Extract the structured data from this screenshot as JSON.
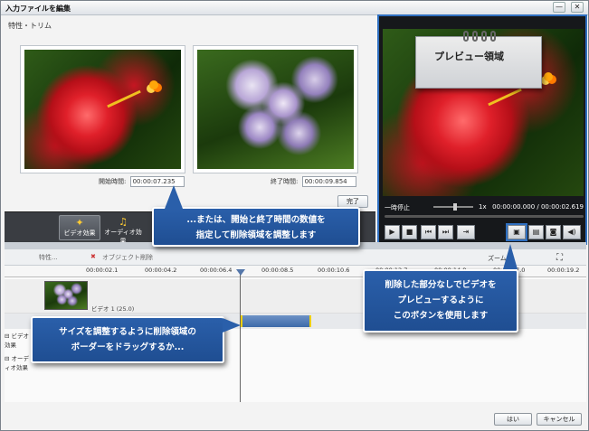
{
  "window": {
    "title": "入力ファイルを編集",
    "min_label": "—",
    "close_label": "✕"
  },
  "section": {
    "label": "特性・トリム"
  },
  "start_time": {
    "label": "開始時間:",
    "value": "00:00:07.235"
  },
  "end_time": {
    "label": "終了時間:",
    "value": "00:00:09.854"
  },
  "complete_button": "完了",
  "effects": [
    {
      "label": "ビデオ効果",
      "icon": "✦"
    },
    {
      "label": "オーディオ効果",
      "icon": "♫"
    }
  ],
  "preview_note": "プレビュー領域",
  "preview": {
    "pause_label": "一時停止",
    "zoom": "1x",
    "time": "00:00:00.000 / 00:00:02.619"
  },
  "player_controls": [
    {
      "name": "play-icon",
      "glyph": "▶"
    },
    {
      "name": "stop-icon",
      "glyph": "■"
    },
    {
      "name": "prev-frame-icon",
      "glyph": "⏮"
    },
    {
      "name": "next-frame-icon",
      "glyph": "⏭"
    },
    {
      "name": "preview-trim-icon",
      "glyph": "⇥"
    },
    {
      "name": "preview-without-deleted-icon",
      "glyph": "▣"
    },
    {
      "name": "snapshot-settings-icon",
      "glyph": "▤"
    },
    {
      "name": "camera-icon",
      "glyph": "◙"
    },
    {
      "name": "volume-icon",
      "glyph": "◀)"
    }
  ],
  "timeline": {
    "tools": [
      "特性...",
      "オブジェクト削除"
    ],
    "zoom_label": "ズーム:",
    "ticks": [
      "00:00:02.1",
      "00:00:04.2",
      "00:00:06.4",
      "00:00:08.5",
      "00:00:10.6",
      "00:00:12.7",
      "00:00:14.8",
      "00:00:17.0",
      "00:00:19.2"
    ],
    "clip_name": "ビデオ 1 (25.0)",
    "rows": [
      "ビデオ効果",
      "オーディオ効果"
    ]
  },
  "footer": {
    "ok": "はい",
    "cancel": "キャンセル"
  },
  "callouts": {
    "top": [
      "...または、開始と終了時間の数値を",
      "指定して削除領域を調整します"
    ],
    "left": [
      "サイズを調整するように削除領域の",
      "ボーダーをドラッグするか..."
    ],
    "right": [
      "削除した部分なしでビデオを",
      "プレビューするように",
      "このボタンを使用します"
    ]
  },
  "colors": {
    "accent": "#2f6fc0",
    "callout": "#1f4e92",
    "trim": "#3d6aa8",
    "handle": "#f0d000"
  }
}
